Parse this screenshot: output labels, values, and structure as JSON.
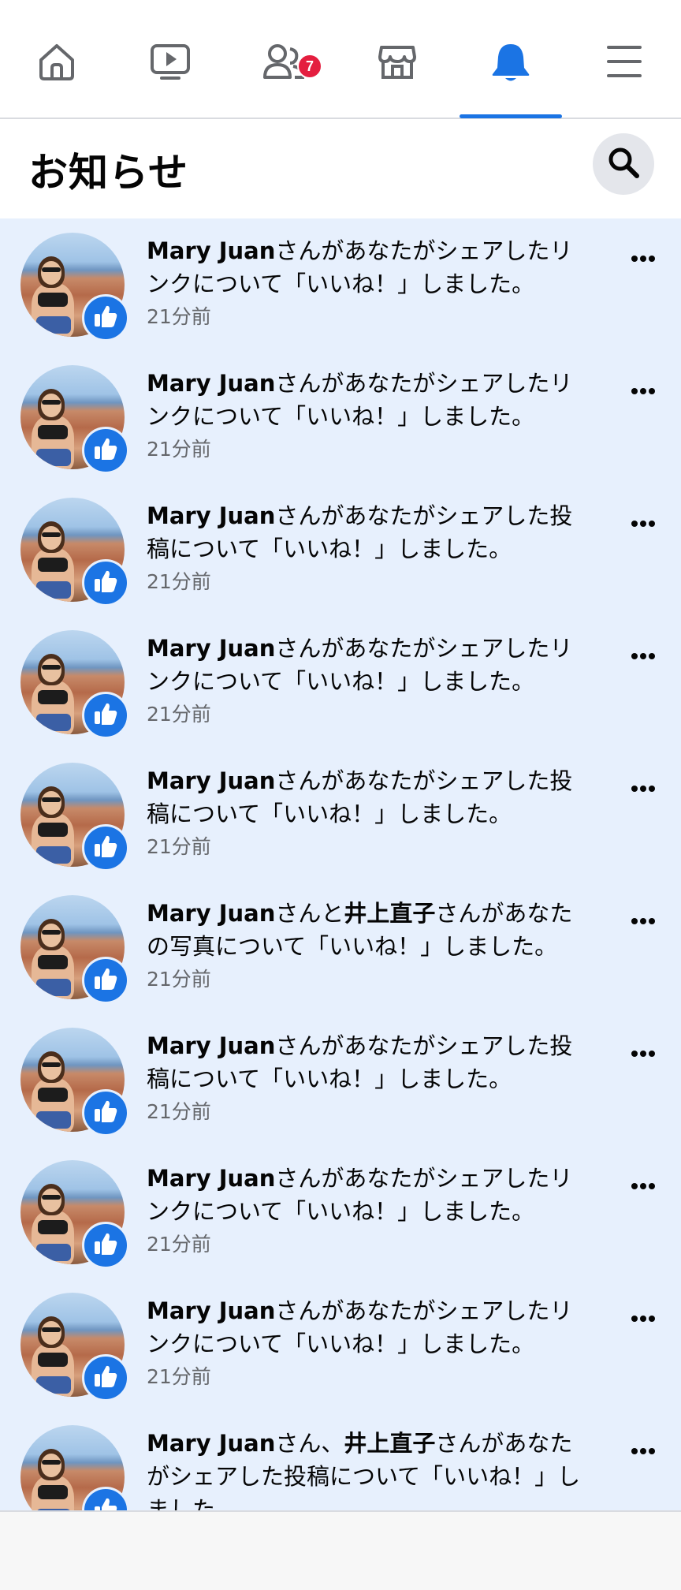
{
  "nav": {
    "tabs": [
      {
        "name": "home",
        "icon": "home-icon"
      },
      {
        "name": "watch",
        "icon": "video-icon"
      },
      {
        "name": "friends",
        "icon": "friends-icon",
        "badge": "7"
      },
      {
        "name": "marketplace",
        "icon": "store-icon"
      },
      {
        "name": "notifications",
        "icon": "bell-icon",
        "active": true
      },
      {
        "name": "menu",
        "icon": "hamburger-menu-icon"
      }
    ]
  },
  "header": {
    "title": "お知らせ",
    "search_icon": "search-icon"
  },
  "colors": {
    "accent": "#1b74e4",
    "unread_background": "#e7f0fd",
    "badge": "#e41e3f",
    "secondary_text": "#65676b"
  },
  "notifications": [
    {
      "actor": "Mary Juan",
      "actor2": "",
      "sep": "",
      "text": "さんがあなたがシェアしたリンクについて「いいね！」しました。",
      "time": "21分前"
    },
    {
      "actor": "Mary Juan",
      "actor2": "",
      "sep": "",
      "text": "さんがあなたがシェアしたリンクについて「いいね！」しました。",
      "time": "21分前"
    },
    {
      "actor": "Mary Juan",
      "actor2": "",
      "sep": "",
      "text": "さんがあなたがシェアした投稿について「いいね！」しました。",
      "time": "21分前"
    },
    {
      "actor": "Mary Juan",
      "actor2": "",
      "sep": "",
      "text": "さんがあなたがシェアしたリンクについて「いいね！」しました。",
      "time": "21分前"
    },
    {
      "actor": "Mary Juan",
      "actor2": "",
      "sep": "",
      "text": "さんがあなたがシェアした投稿について「いいね！」しました。",
      "time": "21分前"
    },
    {
      "actor": "Mary Juan",
      "sep": "さんと",
      "actor2": "井上直子",
      "text": "さんがあなたの写真について「いいね！」しました。",
      "time": "21分前"
    },
    {
      "actor": "Mary Juan",
      "actor2": "",
      "sep": "",
      "text": "さんがあなたがシェアした投稿について「いいね！」しました。",
      "time": "21分前"
    },
    {
      "actor": "Mary Juan",
      "actor2": "",
      "sep": "",
      "text": "さんがあなたがシェアしたリンクについて「いいね！」しました。",
      "time": "21分前"
    },
    {
      "actor": "Mary Juan",
      "actor2": "",
      "sep": "",
      "text": "さんがあなたがシェアしたリンクについて「いいね！」しました。",
      "time": "21分前"
    },
    {
      "actor": "Mary Juan",
      "sep": "さん、",
      "actor2": "井上直子",
      "text": "さんがあなたがシェアした投稿について「いいね！」しました。",
      "time": ""
    }
  ]
}
